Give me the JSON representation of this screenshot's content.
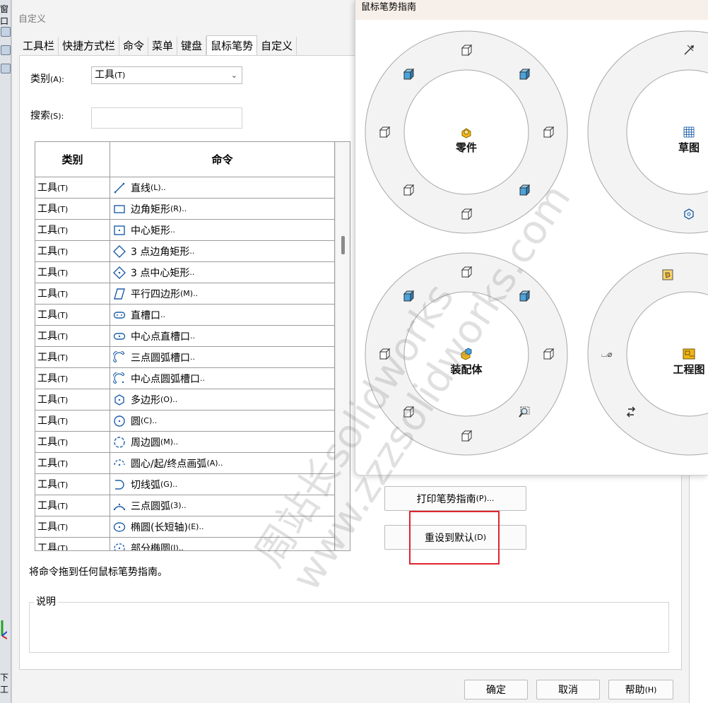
{
  "background_app": {
    "menu_text": "窗口",
    "bottom_text": "下工"
  },
  "dialog": {
    "title": "自定义",
    "tabs": [
      {
        "label": "工具栏",
        "active": false
      },
      {
        "label": "快捷方式栏",
        "active": false
      },
      {
        "label": "命令",
        "active": false
      },
      {
        "label": "菜单",
        "active": false
      },
      {
        "label": "键盘",
        "active": false
      },
      {
        "label": "鼠标笔势",
        "active": true
      },
      {
        "label": "自定义",
        "active": false
      }
    ],
    "category_label": "类别",
    "category_hotkey": "(A):",
    "category_value": "工具",
    "category_value_hotkey": "(T)",
    "search_label": "搜索",
    "search_hotkey": "(S):",
    "search_value": "",
    "table": {
      "col_category": "类别",
      "col_command": "命令",
      "rows": [
        {
          "category": "工具",
          "cat_hotkey": "(T)",
          "icon": "line-icon",
          "command": "直线",
          "cmd_hotkey": "(L).."
        },
        {
          "category": "工具",
          "cat_hotkey": "(T)",
          "icon": "corner-rectangle-icon",
          "command": "边角矩形",
          "cmd_hotkey": "(R).."
        },
        {
          "category": "工具",
          "cat_hotkey": "(T)",
          "icon": "center-rectangle-icon",
          "command": "中心矩形",
          "cmd_hotkey": ".."
        },
        {
          "category": "工具",
          "cat_hotkey": "(T)",
          "icon": "three-point-corner-rectangle-icon",
          "command": "3 点边角矩形",
          "cmd_hotkey": ".."
        },
        {
          "category": "工具",
          "cat_hotkey": "(T)",
          "icon": "three-point-center-rectangle-icon",
          "command": "3 点中心矩形",
          "cmd_hotkey": ".."
        },
        {
          "category": "工具",
          "cat_hotkey": "(T)",
          "icon": "parallelogram-icon",
          "command": "平行四边形",
          "cmd_hotkey": "(M).."
        },
        {
          "category": "工具",
          "cat_hotkey": "(T)",
          "icon": "straight-slot-icon",
          "command": "直槽口",
          "cmd_hotkey": ".."
        },
        {
          "category": "工具",
          "cat_hotkey": "(T)",
          "icon": "center-slot-icon",
          "command": "中心点直槽口",
          "cmd_hotkey": ".."
        },
        {
          "category": "工具",
          "cat_hotkey": "(T)",
          "icon": "three-point-arc-slot-icon",
          "command": "三点圆弧槽口",
          "cmd_hotkey": ".."
        },
        {
          "category": "工具",
          "cat_hotkey": "(T)",
          "icon": "center-arc-slot-icon",
          "command": "中心点圆弧槽口",
          "cmd_hotkey": ".."
        },
        {
          "category": "工具",
          "cat_hotkey": "(T)",
          "icon": "polygon-icon",
          "command": "多边形",
          "cmd_hotkey": "(O).."
        },
        {
          "category": "工具",
          "cat_hotkey": "(T)",
          "icon": "circle-icon",
          "command": "圆",
          "cmd_hotkey": "(C).."
        },
        {
          "category": "工具",
          "cat_hotkey": "(T)",
          "icon": "perimeter-circle-icon",
          "command": "周边圆",
          "cmd_hotkey": "(M).."
        },
        {
          "category": "工具",
          "cat_hotkey": "(T)",
          "icon": "center-arc-icon",
          "command": "圆心/起/终点画弧",
          "cmd_hotkey": "(A).."
        },
        {
          "category": "工具",
          "cat_hotkey": "(T)",
          "icon": "tangent-arc-icon",
          "command": "切线弧",
          "cmd_hotkey": "(G).."
        },
        {
          "category": "工具",
          "cat_hotkey": "(T)",
          "icon": "three-point-arc-icon",
          "command": "三点圆弧",
          "cmd_hotkey": "(3).."
        },
        {
          "category": "工具",
          "cat_hotkey": "(T)",
          "icon": "ellipse-icon",
          "command": "椭圆(长短轴)",
          "cmd_hotkey": "(E).."
        },
        {
          "category": "工具",
          "cat_hotkey": "(T)",
          "icon": "partial-ellipse-icon",
          "command": "部分椭圆",
          "cmd_hotkey": "(I).."
        }
      ]
    },
    "hint_text": "将命令拖到任何鼠标笔势指南。",
    "description_label": "说明",
    "print_button": {
      "label": "打印笔势指南",
      "hotkey": "(P)..."
    },
    "reset_button": {
      "label": "重设到默认",
      "hotkey": "(D)"
    },
    "ok_button": "确定",
    "cancel_button": "取消",
    "help_button": {
      "label": "帮助",
      "hotkey": "(H)"
    }
  },
  "gesture_guide": {
    "title": "鼠标笔势指南",
    "wheels": [
      {
        "label": "零件",
        "center_icon": "part-icon",
        "slot_icons": [
          "top-view-icon",
          "isometric-view-icon",
          "right-view-icon",
          "trimetric-view-icon",
          "bottom-view-icon",
          "front-view-icon",
          "left-view-icon",
          "dimetric-view-icon"
        ]
      },
      {
        "label": "草图",
        "center_icon": "sketch-icon",
        "slot_icons": [
          "smart-dimension-icon",
          "normal-to-icon",
          "line-icon",
          "trim-icon",
          "polygon-icon",
          "unknown-icon",
          "unknown-icon",
          "unknown-icon"
        ]
      },
      {
        "label": "装配体",
        "center_icon": "assembly-icon",
        "slot_icons": [
          "top-view-icon",
          "isometric-view-icon",
          "right-view-icon",
          "zoom-to-fit-icon",
          "bottom-view-icon",
          "front-view-icon",
          "left-view-icon",
          "dimetric-view-icon"
        ]
      },
      {
        "label": "工程图",
        "center_icon": "drawing-icon",
        "slot_icons": [
          "smart-dimension-icon",
          "model-items-icon",
          "hole-callout-icon",
          "alignment-icon",
          "note-icon"
        ]
      }
    ]
  },
  "watermark": {
    "line1": "周站长solidworks",
    "line2": "www.zzzsolidworks.com"
  },
  "colors": {
    "highlight_border": "#e0242c",
    "guide_title_bg": "#f7efe9",
    "icon_blue": "#4aa3dc",
    "icon_yellow": "#f2b619"
  }
}
